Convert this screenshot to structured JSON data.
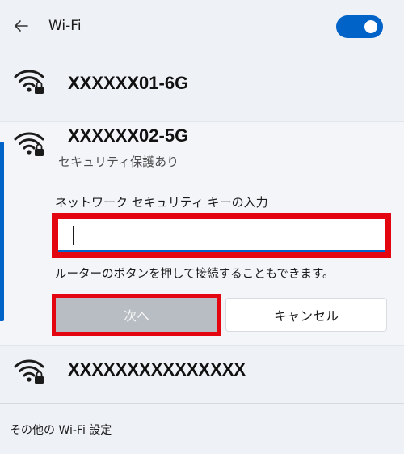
{
  "header": {
    "title": "Wi-Fi",
    "back_icon": "arrow-left-icon",
    "wifi_enabled": true,
    "accent_color": "#0063c8"
  },
  "networks": [
    {
      "ssid": "XXXXXX01-6G",
      "icon": "wifi-secured-icon"
    },
    {
      "ssid": "XXXXXX02-5G",
      "icon": "wifi-secured-icon",
      "status": "セキュリティ保護あり",
      "expanded": true
    },
    {
      "ssid": "XXXXXXXXXXXXXXX",
      "icon": "wifi-secured-icon"
    }
  ],
  "connect_form": {
    "key_label": "ネットワーク セキュリティ キーの入力",
    "key_value": "",
    "hint": "ルーターのボタンを押して接続することもできます。",
    "next_label": "次へ",
    "cancel_label": "キャンセル",
    "highlight_color": "#e3050f"
  },
  "footer": {
    "more_settings_label": "その他の Wi-Fi 設定"
  }
}
